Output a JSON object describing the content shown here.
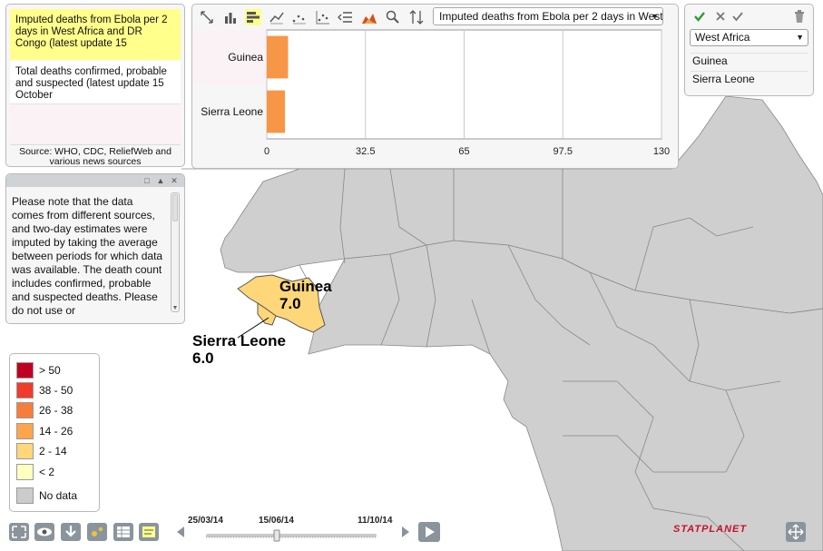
{
  "indicators": {
    "active": "Imputed deaths from Ebola per 2 days in West Africa and DR Congo (latest update 15",
    "second": "Total deaths  confirmed, probable and suspected (latest update 15 October",
    "source": "Source: WHO, CDC, ReliefWeb and various news sources"
  },
  "notes": {
    "text": "Please note that the data comes from different sources, and two-day estimates were imputed by taking the average between periods for which data was available. The death count includes confirmed, probable and suspected deaths. Please do not use or"
  },
  "chart": {
    "selected_indicator": "Imputed deaths from Ebola per 2 days in West Africa and DR Congo",
    "toolbar_icons": [
      "resize-icon",
      "bar-chart-icon",
      "horizontal-bar-icon",
      "line-chart-icon",
      "dot-line-icon",
      "scatter-icon",
      "list-indent-icon",
      "area-chart-icon",
      "zoom-icon",
      "sort-icon"
    ]
  },
  "chart_data": {
    "type": "bar",
    "orientation": "horizontal",
    "categories": [
      "Guinea",
      "Sierra Leone"
    ],
    "values": [
      7.0,
      6.0
    ],
    "xlim": [
      0,
      130
    ],
    "ticks": [
      "0",
      "32.5",
      "65",
      "97.5",
      "130"
    ],
    "bar_color": "#f79646"
  },
  "region": {
    "selected": "West Africa",
    "items": [
      "Guinea",
      "Sierra Leone"
    ]
  },
  "legend": {
    "items": [
      {
        "label": "> 50",
        "color": "#c00020"
      },
      {
        "label": "38 - 50",
        "color": "#f03c2c"
      },
      {
        "label": "26 - 38",
        "color": "#f77d3c"
      },
      {
        "label": "14 - 26",
        "color": "#fca54c"
      },
      {
        "label": "2 - 14",
        "color": "#fdd77a"
      },
      {
        "label": "< 2",
        "color": "#ffffc0"
      },
      {
        "label": "No data",
        "color": "#cccccc"
      }
    ]
  },
  "map": {
    "labels": {
      "guinea": {
        "name": "Guinea",
        "value": "7.0"
      },
      "sierra_leone": {
        "name": "Sierra Leone",
        "value": "6.0"
      }
    }
  },
  "timeline": {
    "start": "25/03/14",
    "current": "15/06/14",
    "end": "11/10/14"
  },
  "brand": "STATPLANET",
  "colors": {
    "highlight": "#ffff8c",
    "land": "#cfcfcf",
    "highlighted_country": "#fdd77a",
    "brand": "#c8102e"
  }
}
